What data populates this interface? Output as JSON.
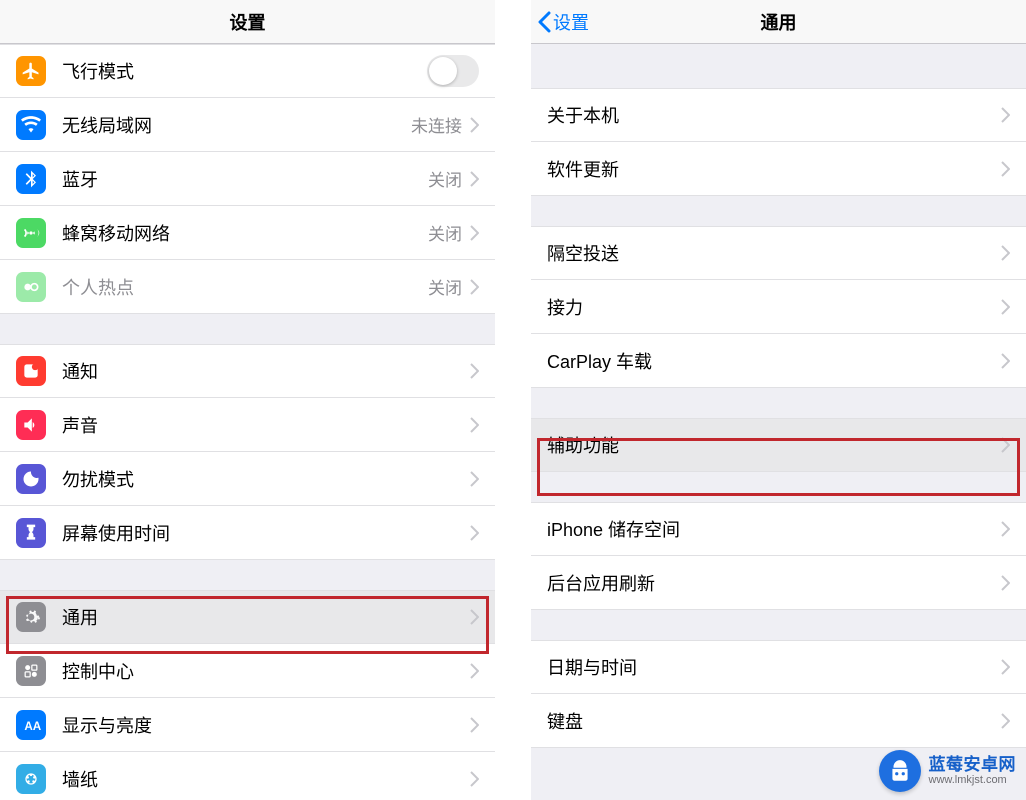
{
  "left": {
    "title": "设置",
    "rows": [
      {
        "icon": "airplane-icon",
        "iconClass": "ic-orange",
        "label": "飞行模式",
        "type": "toggle"
      },
      {
        "icon": "wifi-icon",
        "iconClass": "ic-blue",
        "label": "无线局域网",
        "value": "未连接",
        "type": "link"
      },
      {
        "icon": "bluetooth-icon",
        "iconClass": "ic-bt",
        "label": "蓝牙",
        "value": "关闭",
        "type": "link"
      },
      {
        "icon": "cellular-icon",
        "iconClass": "ic-green",
        "label": "蜂窝移动网络",
        "value": "关闭",
        "type": "link"
      },
      {
        "icon": "hotspot-icon",
        "iconClass": "ic-green2",
        "label": "个人热点",
        "value": "关闭",
        "type": "link",
        "dimmed": true
      }
    ],
    "rows2": [
      {
        "icon": "notifications-icon",
        "iconClass": "ic-red",
        "label": "通知",
        "type": "link"
      },
      {
        "icon": "sounds-icon",
        "iconClass": "ic-pink",
        "label": "声音",
        "type": "link"
      },
      {
        "icon": "dnd-icon",
        "iconClass": "ic-purple",
        "label": "勿扰模式",
        "type": "link"
      },
      {
        "icon": "screentime-icon",
        "iconClass": "ic-purple2",
        "label": "屏幕使用时间",
        "type": "link"
      }
    ],
    "rows3": [
      {
        "icon": "general-icon",
        "iconClass": "ic-gray",
        "label": "通用",
        "type": "link",
        "highlight": true
      },
      {
        "icon": "controlcenter-icon",
        "iconClass": "ic-gray2",
        "label": "控制中心",
        "type": "link"
      },
      {
        "icon": "display-icon",
        "iconClass": "ic-blue2",
        "label": "显示与亮度",
        "type": "link"
      },
      {
        "icon": "wallpaper-icon",
        "iconClass": "ic-cyan",
        "label": "墙纸",
        "type": "link"
      }
    ]
  },
  "right": {
    "back": "设置",
    "title": "通用",
    "g1": [
      {
        "label": "关于本机"
      },
      {
        "label": "软件更新"
      }
    ],
    "g2": [
      {
        "label": "隔空投送"
      },
      {
        "label": "接力"
      },
      {
        "label": "CarPlay 车载"
      }
    ],
    "g3": [
      {
        "label": "辅助功能",
        "highlight": true
      }
    ],
    "g4": [
      {
        "label": "iPhone 储存空间"
      },
      {
        "label": "后台应用刷新"
      }
    ],
    "g5": [
      {
        "label": "日期与时间"
      },
      {
        "label": "键盘"
      }
    ]
  },
  "watermark": {
    "name": "蓝莓安卓网",
    "url": "www.lmkjst.com"
  }
}
